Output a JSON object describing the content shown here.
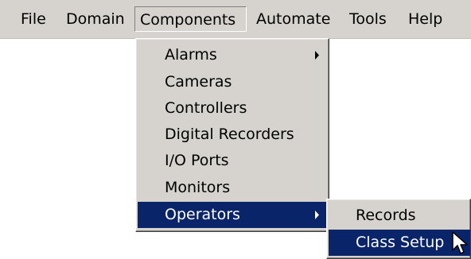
{
  "menubar": {
    "items": [
      {
        "label": "File"
      },
      {
        "label": "Domain"
      },
      {
        "label": "Components"
      },
      {
        "label": "Automate"
      },
      {
        "label": "Tools"
      },
      {
        "label": "Help"
      }
    ],
    "open_item": "Components"
  },
  "components_menu": {
    "items": [
      {
        "label": "Alarms",
        "has_submenu": true
      },
      {
        "label": "Cameras"
      },
      {
        "label": "Controllers"
      },
      {
        "label": "Digital Recorders"
      },
      {
        "label": "I/O Ports"
      },
      {
        "label": "Monitors"
      },
      {
        "label": "Operators",
        "has_submenu": true,
        "highlighted": true
      }
    ]
  },
  "operators_submenu": {
    "items": [
      {
        "label": "Records"
      },
      {
        "label": "Class Setup",
        "highlighted": true
      }
    ]
  },
  "colors": {
    "menu_background": "#d6d3ce",
    "highlight": "#0a246a",
    "highlight_text": "#ffffff",
    "text": "#000000"
  },
  "icons": {
    "submenu_arrow": "right-triangle",
    "cursor": "mouse-pointer-arrow"
  }
}
